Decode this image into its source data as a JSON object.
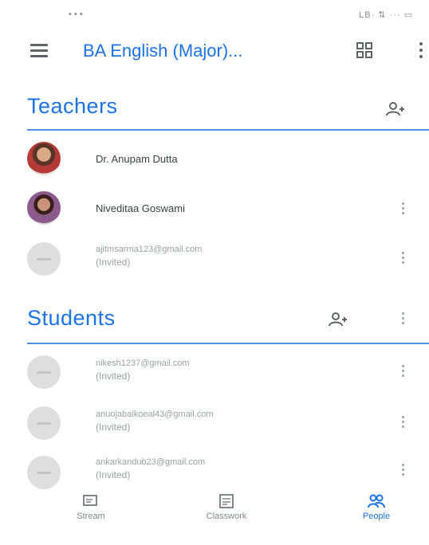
{
  "status_bar": {
    "left": "• • •",
    "right": "LB· ⇅ ··· ▭"
  },
  "app_bar": {
    "title": "BA English (Major)...",
    "icons": [
      "menu-icon",
      "apps-icon",
      "more-vert-icon"
    ]
  },
  "teachers": {
    "title": "Teachers",
    "people": [
      {
        "name": "Dr. Anupam Dutta",
        "status": "",
        "avatar": "photo"
      },
      {
        "name": "Niveditaa Goswami",
        "status": "",
        "avatar": "photo"
      },
      {
        "name": "ajitmsarma123@gmail.com",
        "status": "(Invited)",
        "avatar": "placeholder"
      }
    ]
  },
  "students": {
    "title": "Students",
    "people": [
      {
        "name": "nikesh1237@gmail.com",
        "status": "(Invited)",
        "avatar": "placeholder"
      },
      {
        "name": "anuojabaikoeal43@gmail.com",
        "status": "(Invited)",
        "avatar": "placeholder"
      },
      {
        "name": "ankarkandub23@gmail.com",
        "status": "(Invited)",
        "avatar": "placeholder"
      }
    ]
  },
  "bottom_nav": [
    {
      "label": "Stream",
      "icon": "stream-icon",
      "active": false
    },
    {
      "label": "Classwork",
      "icon": "classwork-icon",
      "active": false
    },
    {
      "label": "People",
      "icon": "people-icon",
      "active": true
    }
  ],
  "colors": {
    "accent": "#1a73e8",
    "text": "#3c4043",
    "muted": "#9aa0a6"
  }
}
